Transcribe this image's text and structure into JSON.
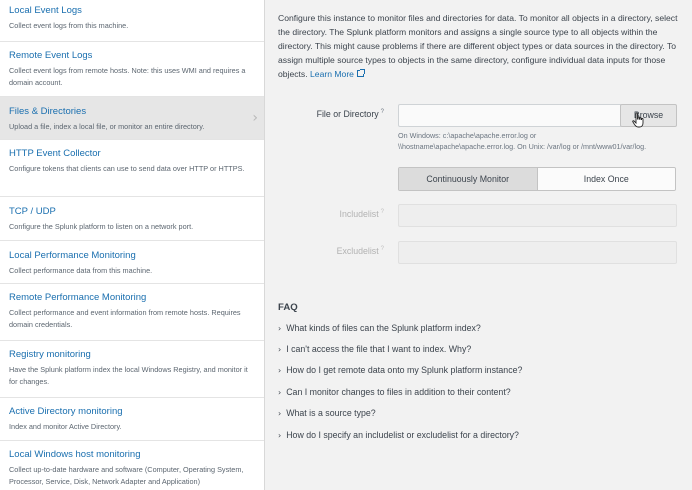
{
  "sidebar": {
    "items": [
      {
        "title": "Local Event Logs",
        "desc": "Collect event logs from this machine."
      },
      {
        "title": "Remote Event Logs",
        "desc": "Collect event logs from remote hosts. Note: this uses WMI and requires a domain account."
      },
      {
        "title": "Files & Directories",
        "desc": "Upload a file, index a local file, or monitor an entire directory."
      },
      {
        "title": "HTTP Event Collector",
        "desc": "Configure tokens that clients can use to send data over HTTP or HTTPS."
      },
      {
        "title": "TCP / UDP",
        "desc": "Configure the Splunk platform to listen on a network port."
      },
      {
        "title": "Local Performance Monitoring",
        "desc": "Collect performance data from this machine."
      },
      {
        "title": "Remote Performance Monitoring",
        "desc": "Collect performance and event information from remote hosts. Requires domain credentials."
      },
      {
        "title": "Registry monitoring",
        "desc": "Have the Splunk platform index the local Windows Registry, and monitor it for changes."
      },
      {
        "title": "Active Directory monitoring",
        "desc": "Index and monitor Active Directory."
      },
      {
        "title": "Local Windows host monitoring",
        "desc": "Collect up-to-date hardware and software (Computer, Operating System, Processor, Service, Disk, Network Adapter and Application)"
      }
    ],
    "chevron": "›"
  },
  "main": {
    "intro": "Configure this instance to monitor files and directories for data. To monitor all objects in a directory, select the directory. The Splunk platform monitors and assigns a single source type to all objects within the directory. This might cause problems if there are different object types or data sources in the directory. To assign multiple source types to objects in the same directory, configure individual data inputs for those objects.",
    "learn_more": "Learn More",
    "file_label": "File or Directory",
    "help_mark": "?",
    "file_value": "",
    "browse": "Browse",
    "hint_line1": "On Windows: c:\\apache\\apache.error.log or",
    "hint_line2": "\\\\hostname\\apache\\apache.error.log. On Unix: /var/log or /mnt/www01/var/log.",
    "modes": [
      "Continuously Monitor",
      "Index Once"
    ],
    "selected_mode": "Continuously Monitor",
    "includelist_label": "Includelist",
    "excludelist_label": "Excludelist",
    "faq_title": "FAQ",
    "faq": [
      "What kinds of files can the Splunk platform index?",
      "I can't access the file that I want to index. Why?",
      "How do I get remote data onto my Splunk platform instance?",
      "Can I monitor changes to files in addition to their content?",
      "What is a source type?",
      "How do I specify an includelist or excludelist for a directory?"
    ],
    "faq_caret": "›"
  },
  "colors": {
    "link": "#1a6faf",
    "active_item": "#e6e6e6",
    "background": "#f2f2f2"
  }
}
